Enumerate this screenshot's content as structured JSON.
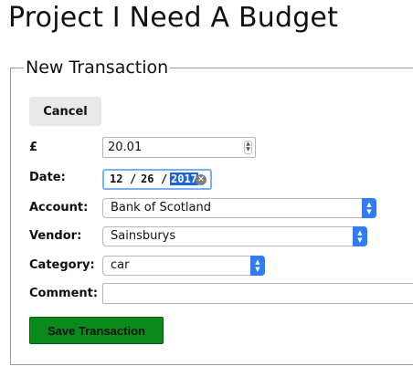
{
  "page": {
    "title": "Project I Need A Budget"
  },
  "form": {
    "legend": "New Transaction",
    "cancel_label": "Cancel",
    "amount": {
      "label": "£",
      "value": "20.01"
    },
    "date": {
      "label": "Date:",
      "month": "12",
      "day": "26",
      "year": "2017",
      "separator": "/"
    },
    "account": {
      "label": "Account:",
      "selected": "Bank of Scotland"
    },
    "vendor": {
      "label": "Vendor:",
      "selected": "Sainsburys"
    },
    "category": {
      "label": "Category:",
      "selected": "car"
    },
    "comment": {
      "label": "Comment:",
      "value": ""
    },
    "save_label": "Save Transaction"
  },
  "colors": {
    "save_button": "#0a8a1b",
    "select_arrow": "#2f7cf6",
    "date_focus": "#7ab0f0",
    "date_selection": "#1a64d6"
  },
  "icons": {
    "stepper": "up-down-arrows",
    "clear": "close-circle",
    "select_arrow": "chevron-up-down"
  }
}
